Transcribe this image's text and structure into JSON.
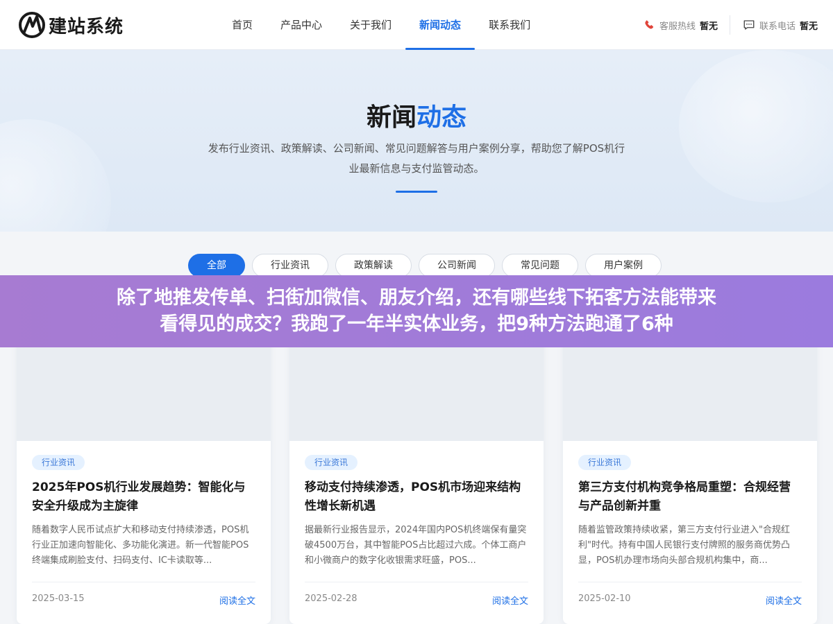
{
  "header": {
    "logo_text": "建站系统",
    "nav": [
      {
        "label": "首页"
      },
      {
        "label": "产品中心"
      },
      {
        "label": "关于我们"
      },
      {
        "label": "新闻动态",
        "active": true
      },
      {
        "label": "联系我们"
      }
    ],
    "hotline": {
      "label": "客服热线",
      "value": "暂无",
      "icon": "phone-icon"
    },
    "phone": {
      "label": "联系电话",
      "value": "暂无",
      "icon": "chat-icon"
    }
  },
  "hero": {
    "title_main": "新闻",
    "title_accent": "动态",
    "subtitle_line1": "发布行业资讯、政策解读、公司新闻、常见问题解答与用户案例分享，帮助您了解POS机行",
    "subtitle_line2": "业最新信息与支付监管动态。"
  },
  "filters": [
    {
      "label": "全部",
      "active": true
    },
    {
      "label": "行业资讯"
    },
    {
      "label": "政策解读"
    },
    {
      "label": "公司新闻"
    },
    {
      "label": "常见问题"
    },
    {
      "label": "用户案例"
    }
  ],
  "banner": {
    "line1": "除了地推发传单、扫街加微信、朋友介绍，还有哪些线下拓客方法能带来",
    "line2": "看得见的成交？我跑了一年半实体业务，把9种方法跑通了6种"
  },
  "cards": [
    {
      "tag": "行业资讯",
      "title": "2025年POS机行业发展趋势：智能化与安全升级成为主旋律",
      "desc": "随着数字人民币试点扩大和移动支付持续渗透，POS机行业正加速向智能化、多功能化演进。新一代智能POS终端集成刷脸支付、扫码支付、IC卡读取等...",
      "date": "2025-03-15",
      "more": "阅读全文"
    },
    {
      "tag": "行业资讯",
      "title": "移动支付持续渗透，POS机市场迎来结构性增长新机遇",
      "desc": "据最新行业报告显示，2024年国内POS机终端保有量突破4500万台，其中智能POS占比超过六成。个体工商户和小微商户的数字化收银需求旺盛，POS...",
      "date": "2025-02-28",
      "more": "阅读全文"
    },
    {
      "tag": "行业资讯",
      "title": "第三方支付机构竞争格局重塑：合规经营与产品创新并重",
      "desc": "随着监管政策持续收紧，第三方支付行业进入\"合规红利\"时代。持有中国人民银行支付牌照的服务商优势凸显，POS机办理市场向头部合规机构集中，商...",
      "date": "2025-02-10",
      "more": "阅读全文"
    }
  ],
  "colors": {
    "accent": "#1e6fe6",
    "banner": "#a07bd8",
    "tag_bg": "#e5f1ff"
  }
}
